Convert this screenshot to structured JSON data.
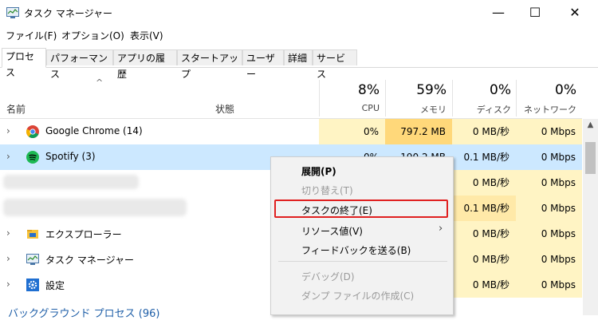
{
  "window": {
    "title": "タスク マネージャー",
    "minimize": "—",
    "maximize": "☐",
    "close": "✕"
  },
  "menu": [
    "ファイル(F)",
    "オプション(O)",
    "表示(V)"
  ],
  "tabs": [
    "プロセス",
    "パフォーマンス",
    "アプリの履歴",
    "スタートアップ",
    "ユーザー",
    "詳細",
    "サービス"
  ],
  "header": {
    "sort_indicator": "^",
    "name": "名前",
    "status": "状態",
    "cpu_pct": "8%",
    "cpu": "CPU",
    "mem_pct": "59%",
    "mem": "メモリ",
    "disk_pct": "0%",
    "disk": "ディスク",
    "net_pct": "0%",
    "net": "ネットワーク"
  },
  "rows": [
    {
      "name": "Google Chrome (14)",
      "cpu": "0%",
      "mem": "797.2 MB",
      "disk": "0 MB/秒",
      "net": "0 Mbps"
    },
    {
      "name": "Spotify (3)",
      "cpu": "0%",
      "mem": "190.2 MB",
      "disk": "0.1 MB/秒",
      "net": "0 Mbps"
    },
    {
      "name": "",
      "cpu": "",
      "mem": "",
      "disk": "0 MB/秒",
      "net": "0 Mbps"
    },
    {
      "name": "",
      "cpu": "",
      "mem": "",
      "disk": "0.1 MB/秒",
      "net": "0 Mbps"
    },
    {
      "name": "エクスプローラー",
      "cpu": "",
      "mem": "",
      "disk": "0 MB/秒",
      "net": "0 Mbps"
    },
    {
      "name": "タスク マネージャー",
      "cpu": "",
      "mem": "",
      "disk": "0 MB/秒",
      "net": "0 Mbps"
    },
    {
      "name": "設定",
      "cpu": "",
      "mem": "",
      "disk": "0 MB/秒",
      "net": "0 Mbps"
    }
  ],
  "background_section": "バックグラウンド プロセス (96)",
  "context_menu": {
    "expand": "展開(P)",
    "switch": "切り替え(T)",
    "end_task": "タスクの終了(E)",
    "resource_values": "リソース値(V)",
    "submenu_arrow": "›",
    "feedback": "フィードバックを送る(B)",
    "debug": "デバッグ(D)",
    "dump": "ダンプ ファイルの作成(C)"
  },
  "colors": {
    "highlight_border": "#e02020",
    "selected_row": "#cce8ff",
    "heat_light": "#fff4c4",
    "heat_dark": "#ffd87a"
  }
}
